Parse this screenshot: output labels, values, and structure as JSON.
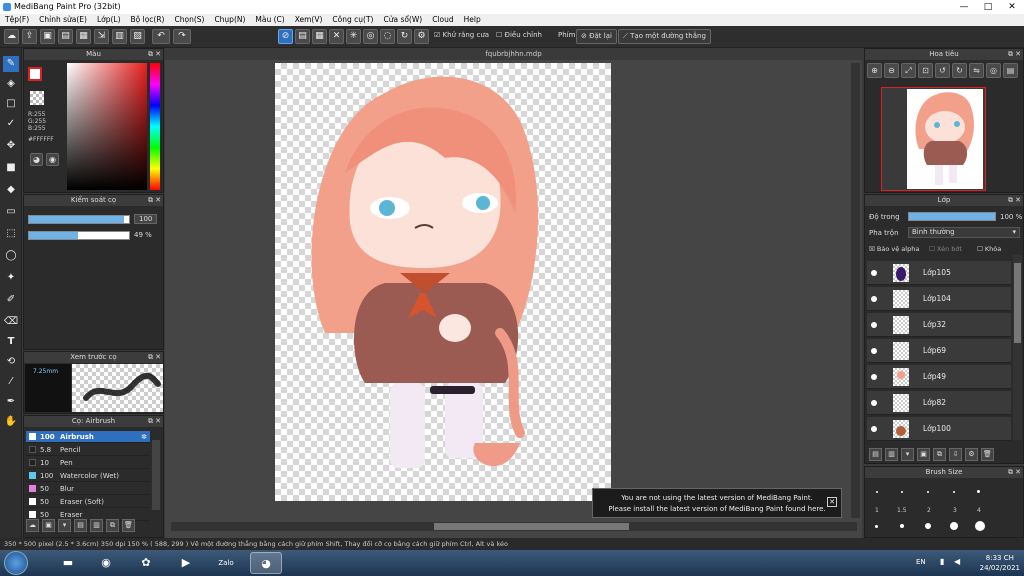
{
  "window": {
    "title": "MediBang Paint Pro (32bit)",
    "controls": [
      "—",
      "□",
      "✕"
    ]
  },
  "menu": [
    "Tệp(F)",
    "Chỉnh sửa(E)",
    "Lớp(L)",
    "Bộ lọc(R)",
    "Chọn(S)",
    "Chụp(N)",
    "Màu (C)",
    "Xem(V)",
    "Công cụ(T)",
    "Cửa sổ(W)",
    "Cloud",
    "Help"
  ],
  "toolbar": {
    "antialias": "Khử răng cưa",
    "adjust": "Điều chỉnh",
    "pen_label": "Phím",
    "reset": "Đặt lại",
    "straight_line": "Tạo một đường thẳng"
  },
  "color_panel": {
    "title": "Màu",
    "r": "R:255",
    "g": "G:255",
    "b": "B:255",
    "hex": "#FFFFFF",
    "fg_color": "#FFFFFF"
  },
  "brush_control": {
    "title": "Kiểm soát cọ",
    "size": "100",
    "opacity": "49 %",
    "size_fraction": 0.95,
    "opacity_fraction": 0.49
  },
  "brush_preview": {
    "title": "Xem trước cọ",
    "size_label": "7.25mm"
  },
  "brush_list": {
    "title": "Cọ: Airbrush",
    "items": [
      {
        "size": "100",
        "name": "Airbrush",
        "color": "#FFFFFF"
      },
      {
        "size": "5.8",
        "name": "Pencil",
        "color": "#222222"
      },
      {
        "size": "10",
        "name": "Pen",
        "color": "#222222"
      },
      {
        "size": "100",
        "name": "Watercolor (Wet)",
        "color": "#5ec8e8"
      },
      {
        "size": "50",
        "name": "Blur",
        "color": "#e080e0"
      },
      {
        "size": "50",
        "name": "Eraser (Soft)",
        "color": "#ffffff"
      },
      {
        "size": "50",
        "name": "Eraser",
        "color": "#ffffff"
      }
    ]
  },
  "canvas": {
    "doc_title": "fqubrbjhhn.mdp"
  },
  "notice": {
    "line1": "You are not using the latest version of MediBang Paint.",
    "line2": "Please install the latest version of MediBang Paint found here.",
    "close": "✕"
  },
  "navigator": {
    "title": "Hoa tiêu"
  },
  "layers": {
    "title": "Lớp",
    "opacity_label": "Độ trong",
    "opacity_value": "100 %",
    "blend_label": "Pha trộn",
    "blend_value": "Bình thường",
    "protect_alpha": "Bảo vệ alpha",
    "clipping": "Xén bớt",
    "lock": "Khóa",
    "items": [
      "Lớp105",
      "Lớp104",
      "Lớp32",
      "Lớp69",
      "Lớp49",
      "Lớp82",
      "Lớp100"
    ]
  },
  "brush_size": {
    "title": "Brush Size",
    "labels": [
      "1",
      "1.5",
      "2",
      "3",
      "4"
    ]
  },
  "status": "350 * 500 pixel   (2.5 * 3.6cm)   350 dpi   150 %   ( 588, 299 )   Vẽ một đường thẳng bằng cách giữ phím Shift, Thay đổi cỡ cọ bằng cách giữ phím Ctrl, Alt và kéo",
  "taskbar": {
    "lang": "EN",
    "time": "8:33 CH",
    "date": "24/02/2021",
    "zalo": "Zalo"
  }
}
